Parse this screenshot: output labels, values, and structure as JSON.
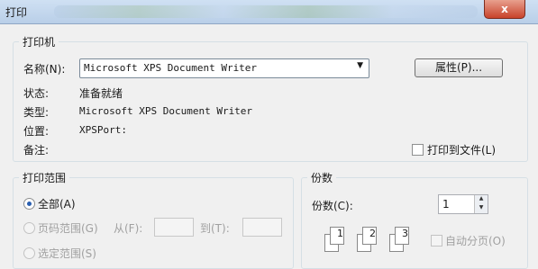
{
  "window": {
    "title": "打印",
    "close": "x"
  },
  "printer_group": {
    "label": "打印机",
    "name_label": "名称(N):",
    "name_value": "Microsoft XPS Document Writer",
    "properties_button": "属性(P)...",
    "status_label": "状态:",
    "status_value": "准备就绪",
    "type_label": "类型:",
    "type_value": "Microsoft XPS Document Writer",
    "where_label": "位置:",
    "where_value": "XPSPort:",
    "comment_label": "备注:",
    "print_to_file": "打印到文件(L)"
  },
  "range_group": {
    "label": "打印范围",
    "all": "全部(A)",
    "pages": "页码范围(G)",
    "from": "从(F):",
    "to": "到(T):",
    "selection": "选定范围(S)"
  },
  "copies_group": {
    "label": "份数",
    "copies_label": "份数(C):",
    "copies_value": "1",
    "collate": "自动分页(O)",
    "collate_pages": [
      "1",
      "1",
      "2",
      "2",
      "3",
      "3"
    ]
  }
}
